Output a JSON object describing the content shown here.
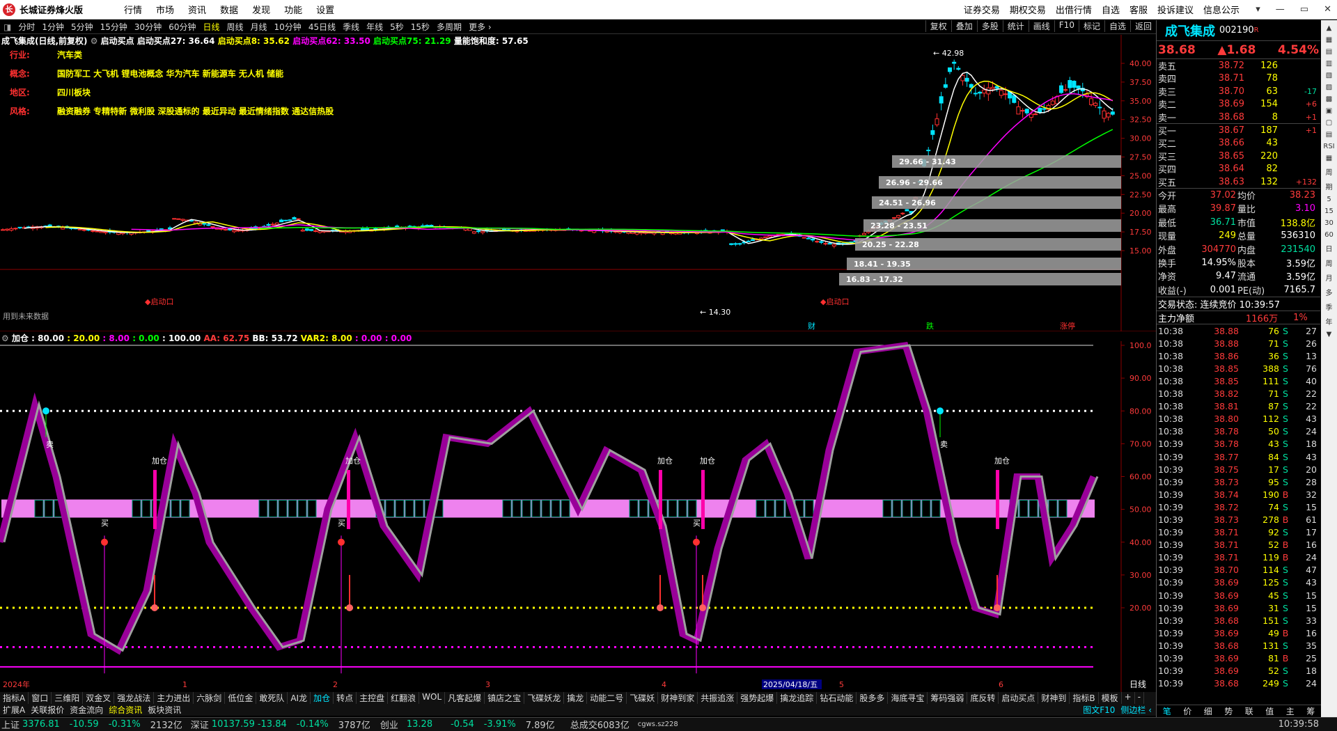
{
  "app": {
    "title": "长城证券烽火版",
    "logo": "长",
    "menu": [
      "行情",
      "市场",
      "资讯",
      "数据",
      "发现",
      "功能",
      "设置"
    ],
    "right_menu": [
      "证券交易",
      "期权交易",
      "出借行情",
      "自选",
      "客服",
      "投诉建议",
      "信息公示"
    ],
    "win": [
      "▾",
      "—",
      "▭",
      "✕"
    ]
  },
  "periods": [
    "分时",
    "1分钟",
    "5分钟",
    "15分钟",
    "30分钟",
    "60分钟",
    "日线",
    "周线",
    "月线",
    "10分钟",
    "45日线",
    "季线",
    "年线",
    "5秒",
    "15秒",
    "多周期",
    "更多 ›"
  ],
  "active_period": "日线",
  "tools": [
    "复权",
    "叠加",
    "多股",
    "统计",
    "画线",
    "F10",
    "标记",
    "自选",
    "返回"
  ],
  "main_info": {
    "name": "成飞集成(日线,前复权)",
    "ind": "启动买点",
    "b27": "启动买点27: 36.64",
    "b8": "启动买点8: 35.62",
    "b62": "启动买点62: 33.50",
    "b75": "启动买点75: 21.29",
    "vol": "量能饱和度: 57.65"
  },
  "info": [
    {
      "k": "行业:",
      "v": "汽车类"
    },
    {
      "k": "概念:",
      "v": "国防军工 大飞机 锂电池概念 华为汽车 新能源车 无人机 储能"
    },
    {
      "k": "地区:",
      "v": "四川板块"
    },
    {
      "k": "风格:",
      "v": "融资融券 专精特新 微利股 深股通标的 最近异动 最近情绪指数 通达信热股"
    }
  ],
  "labels": {
    "high": "42.98",
    "low": "14.30",
    "future": "用到未来数据",
    "start1": "启动口",
    "start2": "启动口",
    "cai": "财",
    "die": "跌",
    "zhangting": "涨停",
    "buy": "买",
    "sell": "卖",
    "add": "加仓"
  },
  "zones": [
    "29.66 - 31.43",
    "26.96 - 29.66",
    "24.51 - 26.96",
    "23.28 - 23.51",
    "20.25 - 22.28",
    "18.41 - 19.35",
    "16.83 - 17.32"
  ],
  "price_axis": [
    "40.00",
    "37.50",
    "35.00",
    "32.50",
    "30.00",
    "27.50",
    "25.00",
    "22.50",
    "20.00",
    "17.50",
    "15.00"
  ],
  "ind_axis": [
    "100.0",
    "90.00",
    "80.00",
    "70.00",
    "60.00",
    "50.00",
    "40.00",
    "30.00",
    "20.00"
  ],
  "ind_info": {
    "name": "加仓",
    "a": ": 80.00",
    "b": ": 20.00",
    "c": ": 8.00",
    "d": ": 0.00",
    "e": ": 100.00",
    "aa": "AA: 62.75",
    "bb": "BB: 53.72",
    "var2": "VAR2: 8.00",
    "f": ": 0.00",
    "g": ": 0.00"
  },
  "date_axis": [
    "2024年",
    "1",
    "2",
    "3",
    "4",
    "2025/04/18/五",
    "5",
    "6"
  ],
  "day_label": "日线",
  "tabs1": [
    "指标A",
    "窗口",
    "三维阳",
    "双金叉",
    "强龙战法",
    "主力进出",
    "六脉剑",
    "低位金",
    "敢死队",
    "AI龙",
    "加仓",
    "转点",
    "主控盘",
    "红翻浪",
    "WOL",
    "凡客起爆",
    "镇店之宝",
    "飞碟妖龙",
    "擒龙",
    "动能二号",
    "飞碟妖",
    "财神到家",
    "共振追涨",
    "强势起爆",
    "擒龙追踪",
    "钻石动能",
    "股多多",
    "海底寻宝",
    "筹码强弱",
    "底反转",
    "启动买点",
    "财神到",
    "指标B",
    "模板",
    "+",
    "-"
  ],
  "active_tab1": "加仓",
  "tabs2": [
    "扩展A",
    "关联报价",
    "资金流向",
    "综合资讯",
    "板块资讯"
  ],
  "active_tab2": "综合资讯",
  "tabs2_right": [
    "图文F10",
    "侧边栏 ‹"
  ],
  "stock": {
    "name": "成飞集成",
    "code": "002190",
    "flag": "R",
    "price": "38.68",
    "change": "▲1.68",
    "pct": "4.54%"
  },
  "asks": [
    {
      "l": "卖五",
      "p": "38.72",
      "v": "126",
      "c": ""
    },
    {
      "l": "卖四",
      "p": "38.71",
      "v": "78",
      "c": ""
    },
    {
      "l": "卖三",
      "p": "38.70",
      "v": "63",
      "c": "-17"
    },
    {
      "l": "卖二",
      "p": "38.69",
      "v": "154",
      "c": "+6"
    },
    {
      "l": "卖一",
      "p": "38.68",
      "v": "8",
      "c": "+1"
    }
  ],
  "bids": [
    {
      "l": "买一",
      "p": "38.67",
      "v": "187",
      "c": "+1"
    },
    {
      "l": "买二",
      "p": "38.66",
      "v": "43",
      "c": ""
    },
    {
      "l": "买三",
      "p": "38.65",
      "v": "220",
      "c": ""
    },
    {
      "l": "买四",
      "p": "38.64",
      "v": "82",
      "c": ""
    },
    {
      "l": "买五",
      "p": "38.63",
      "v": "132",
      "c": "+132"
    }
  ],
  "stats": [
    [
      "今开",
      "37.02",
      "均价",
      "38.23"
    ],
    [
      "最高",
      "39.87",
      "量比",
      "3.10"
    ],
    [
      "最低",
      "36.71",
      "市值",
      "138.8亿"
    ],
    [
      "现量",
      "249",
      "总量",
      "536310"
    ],
    [
      "外盘",
      "304770",
      "内盘",
      "231540"
    ],
    [
      "换手",
      "14.95%",
      "股本",
      "3.59亿"
    ],
    [
      "净资",
      "9.47",
      "流通",
      "3.59亿"
    ],
    [
      "收益(-)",
      "0.001",
      "PE(动)",
      "7165.7"
    ]
  ],
  "trade_status": "交易状态: 连续竞价 10:39:57",
  "netflow": {
    "label": "主力净额",
    "value": "1166万",
    "pct": "1%"
  },
  "ticks": [
    [
      "10:38",
      "38.88",
      "76",
      "S",
      "27"
    ],
    [
      "10:38",
      "38.88",
      "71",
      "S",
      "26"
    ],
    [
      "10:38",
      "38.86",
      "36",
      "S",
      "13"
    ],
    [
      "10:38",
      "38.85",
      "388",
      "S",
      "76"
    ],
    [
      "10:38",
      "38.85",
      "111",
      "S",
      "40"
    ],
    [
      "10:38",
      "38.82",
      "71",
      "S",
      "22"
    ],
    [
      "10:38",
      "38.81",
      "87",
      "S",
      "22"
    ],
    [
      "10:38",
      "38.80",
      "112",
      "S",
      "43"
    ],
    [
      "10:38",
      "38.78",
      "50",
      "S",
      "24"
    ],
    [
      "10:39",
      "38.78",
      "43",
      "S",
      "18"
    ],
    [
      "10:39",
      "38.77",
      "84",
      "S",
      "43"
    ],
    [
      "10:39",
      "38.75",
      "17",
      "S",
      "20"
    ],
    [
      "10:39",
      "38.73",
      "95",
      "S",
      "28"
    ],
    [
      "10:39",
      "38.74",
      "190",
      "B",
      "32"
    ],
    [
      "10:39",
      "38.72",
      "74",
      "S",
      "15"
    ],
    [
      "10:39",
      "38.73",
      "278",
      "B",
      "61"
    ],
    [
      "10:39",
      "38.71",
      "92",
      "S",
      "17"
    ],
    [
      "10:39",
      "38.71",
      "52",
      "B",
      "16"
    ],
    [
      "10:39",
      "38.71",
      "119",
      "B",
      "24"
    ],
    [
      "10:39",
      "38.70",
      "114",
      "S",
      "47"
    ],
    [
      "10:39",
      "38.69",
      "125",
      "S",
      "43"
    ],
    [
      "10:39",
      "38.69",
      "45",
      "S",
      "15"
    ],
    [
      "10:39",
      "38.69",
      "31",
      "S",
      "15"
    ],
    [
      "10:39",
      "38.68",
      "151",
      "S",
      "33"
    ],
    [
      "10:39",
      "38.69",
      "49",
      "B",
      "16"
    ],
    [
      "10:39",
      "38.68",
      "131",
      "S",
      "35"
    ],
    [
      "10:39",
      "38.69",
      "81",
      "B",
      "25"
    ],
    [
      "10:39",
      "38.69",
      "52",
      "S",
      "18"
    ],
    [
      "10:39",
      "38.68",
      "249",
      "S",
      "24"
    ]
  ],
  "rp_tabs": [
    "笔",
    "价",
    "细",
    "势",
    "联",
    "值",
    "主",
    "筹"
  ],
  "status": {
    "sh": "上证",
    "sh_v": "3376.81",
    "sh_c": "-10.59",
    "sh_p": "-0.31%",
    "sh_a": "2132亿",
    "sz": "深证",
    "sz_v": "10137.59",
    "sz_c": "-13.84",
    "sz_p": "-0.14%",
    "sz_a": "3787亿",
    "cy": "创业",
    "cy_v": "13.28",
    "cy_c": "-0.54",
    "cy_p": "-3.91%",
    "cy_a": "7.89亿",
    "total": "总成交6083亿",
    "srv": "cgws.sz228",
    "time": "10:39:58"
  },
  "side": [
    "▲",
    "▦",
    "▤",
    "▥",
    "▧",
    "▨",
    "▩",
    "▣",
    "▢",
    "▤",
    "RSI",
    "▦",
    "周",
    "期",
    "5",
    "15",
    "30",
    "60",
    "日",
    "周",
    "月",
    "多",
    "季",
    "年",
    "▼"
  ]
}
